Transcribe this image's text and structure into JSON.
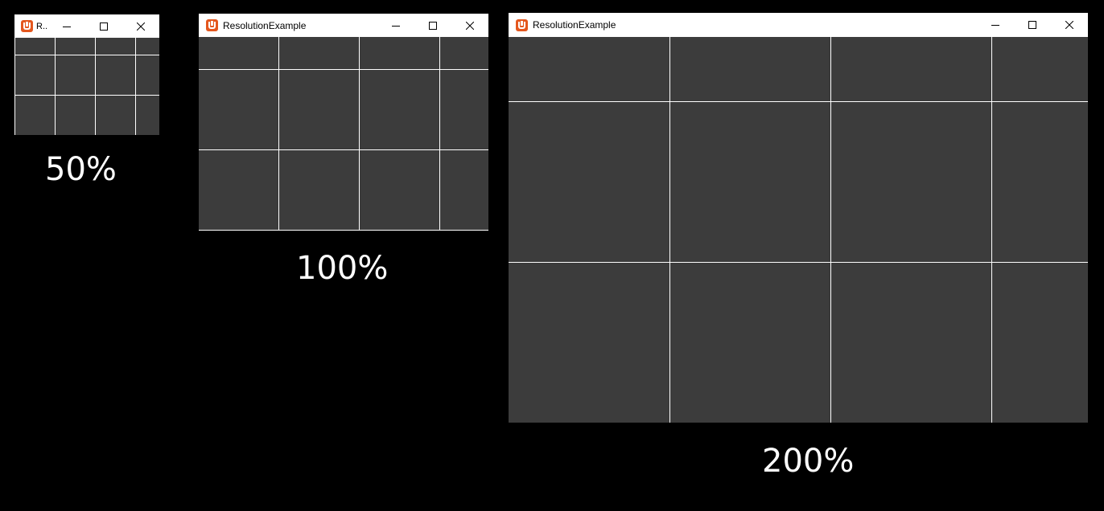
{
  "windows": [
    {
      "scale": "50%",
      "title": "R..",
      "minimize_icon": "minimize-icon",
      "maximize_icon": "maximize-icon",
      "close_icon": "close-icon"
    },
    {
      "scale": "100%",
      "title": "ResolutionExample",
      "minimize_icon": "minimize-icon",
      "maximize_icon": "maximize-icon",
      "close_icon": "close-icon"
    },
    {
      "scale": "200%",
      "title": "ResolutionExample",
      "minimize_icon": "minimize-icon",
      "maximize_icon": "maximize-icon",
      "close_icon": "close-icon"
    }
  ],
  "colors": {
    "background": "#000000",
    "client_area": "#3c3c3c",
    "grid_lines": "#ffffff",
    "app_icon": "#e4571e"
  }
}
